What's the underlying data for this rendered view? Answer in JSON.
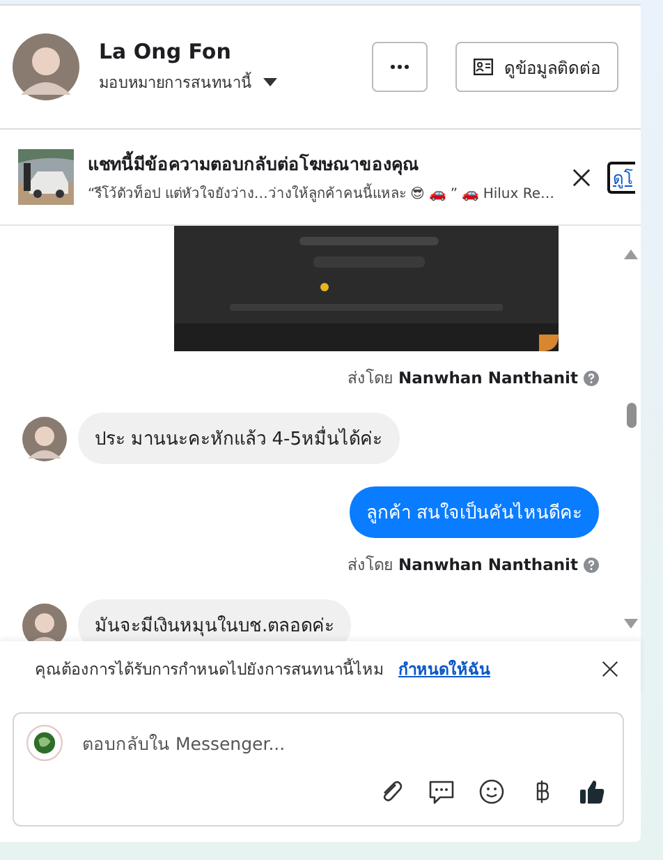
{
  "contact": {
    "name": "La Ong Fon",
    "assign_label": "มอบหมายการสนทนานี้"
  },
  "contact_button": {
    "label": "ดูข้อมูลติดต่อ"
  },
  "ad_banner": {
    "title": "แชทนี้มีข้อความตอบกลับต่อโฆษณาของคุณ",
    "preview": "“รีโว้ตัวท็อป แต่หัวใจยังว่าง…ว่างให้ลูกค้าคนนี้แหละ 😎 🚗 ” 🚗 Hilux Re…",
    "link": "ดูโ"
  },
  "messages": [
    {
      "sent_by_prefix": "ส่งโดย",
      "sent_by": "Nanwhan Nanthanit"
    },
    {
      "kind": "incoming",
      "text": "ประ มานนะคะหักแล้ว 4-5หมื่นได้ค่ะ"
    },
    {
      "kind": "outgoing",
      "text": "ลูกค้า สนใจเป็นคันไหนดีคะ",
      "sent_by_prefix": "ส่งโดย",
      "sent_by": "Nanwhan Nanthanit"
    },
    {
      "kind": "incoming",
      "text": "มันจะมีเงินหมุนในบช.ตลอดค่ะ"
    }
  ],
  "assign_prompt": {
    "text": "คุณต้องการได้รับการกำหนดไปยังการสนทนานี้ไหม",
    "link": "กำหนดให้ฉัน"
  },
  "composer": {
    "placeholder": "ตอบกลับใน Messenger..."
  }
}
